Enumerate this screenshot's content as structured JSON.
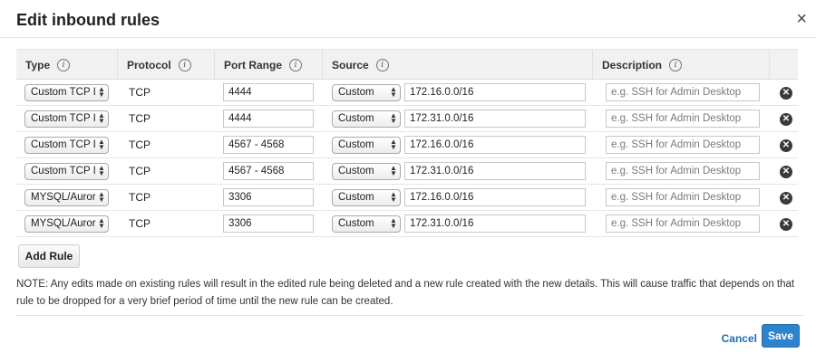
{
  "header": {
    "title": "Edit inbound rules",
    "close_icon": "×"
  },
  "columns": [
    {
      "label": "Type",
      "info": "i"
    },
    {
      "label": "Protocol",
      "info": "i"
    },
    {
      "label": "Port Range",
      "info": "i"
    },
    {
      "label": "Source",
      "info": "i"
    },
    {
      "label": "Description",
      "info": "i"
    }
  ],
  "rules": [
    {
      "type": "Custom TCP I",
      "protocol": "TCP",
      "port_range": "4444",
      "source_type": "Custom",
      "source": "172.16.0.0/16",
      "description_placeholder": "e.g. SSH for Admin Desktop"
    },
    {
      "type": "Custom TCP I",
      "protocol": "TCP",
      "port_range": "4444",
      "source_type": "Custom",
      "source": "172.31.0.0/16",
      "description_placeholder": "e.g. SSH for Admin Desktop"
    },
    {
      "type": "Custom TCP I",
      "protocol": "TCP",
      "port_range": "4567 - 4568",
      "source_type": "Custom",
      "source": "172.16.0.0/16",
      "description_placeholder": "e.g. SSH for Admin Desktop"
    },
    {
      "type": "Custom TCP I",
      "protocol": "TCP",
      "port_range": "4567 - 4568",
      "source_type": "Custom",
      "source": "172.31.0.0/16",
      "description_placeholder": "e.g. SSH for Admin Desktop"
    },
    {
      "type": "MYSQL/Auror",
      "protocol": "TCP",
      "port_range": "3306",
      "source_type": "Custom",
      "source": "172.16.0.0/16",
      "description_placeholder": "e.g. SSH for Admin Desktop"
    },
    {
      "type": "MYSQL/Auror",
      "protocol": "TCP",
      "port_range": "3306",
      "source_type": "Custom",
      "source": "172.31.0.0/16",
      "description_placeholder": "e.g. SSH for Admin Desktop"
    }
  ],
  "add_rule_label": "Add Rule",
  "note": "NOTE: Any edits made on existing rules will result in the edited rule being deleted and a new rule created with the new details. This will cause traffic that depends on that rule to be dropped for a very brief period of time until the new rule can be created.",
  "footer": {
    "cancel_label": "Cancel",
    "save_label": "Save"
  },
  "icons": {
    "select_arrows": "select-arrows-icon",
    "delete": "remove-circle-icon",
    "info": "info-circle-icon",
    "close": "close-icon"
  },
  "colors": {
    "primary": "#2e84cc",
    "link": "#1a6fb3"
  }
}
